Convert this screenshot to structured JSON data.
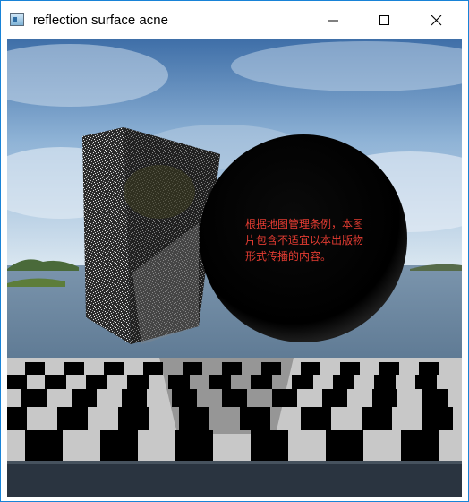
{
  "window": {
    "title": "reflection surface acne"
  },
  "controls": {
    "minimize": "minimize-icon",
    "maximize": "maximize-icon",
    "close": "close-icon"
  },
  "overlay": {
    "notice": "根据地图管理条例，本图片包含不适宜以本出版物形式传播的内容。"
  }
}
